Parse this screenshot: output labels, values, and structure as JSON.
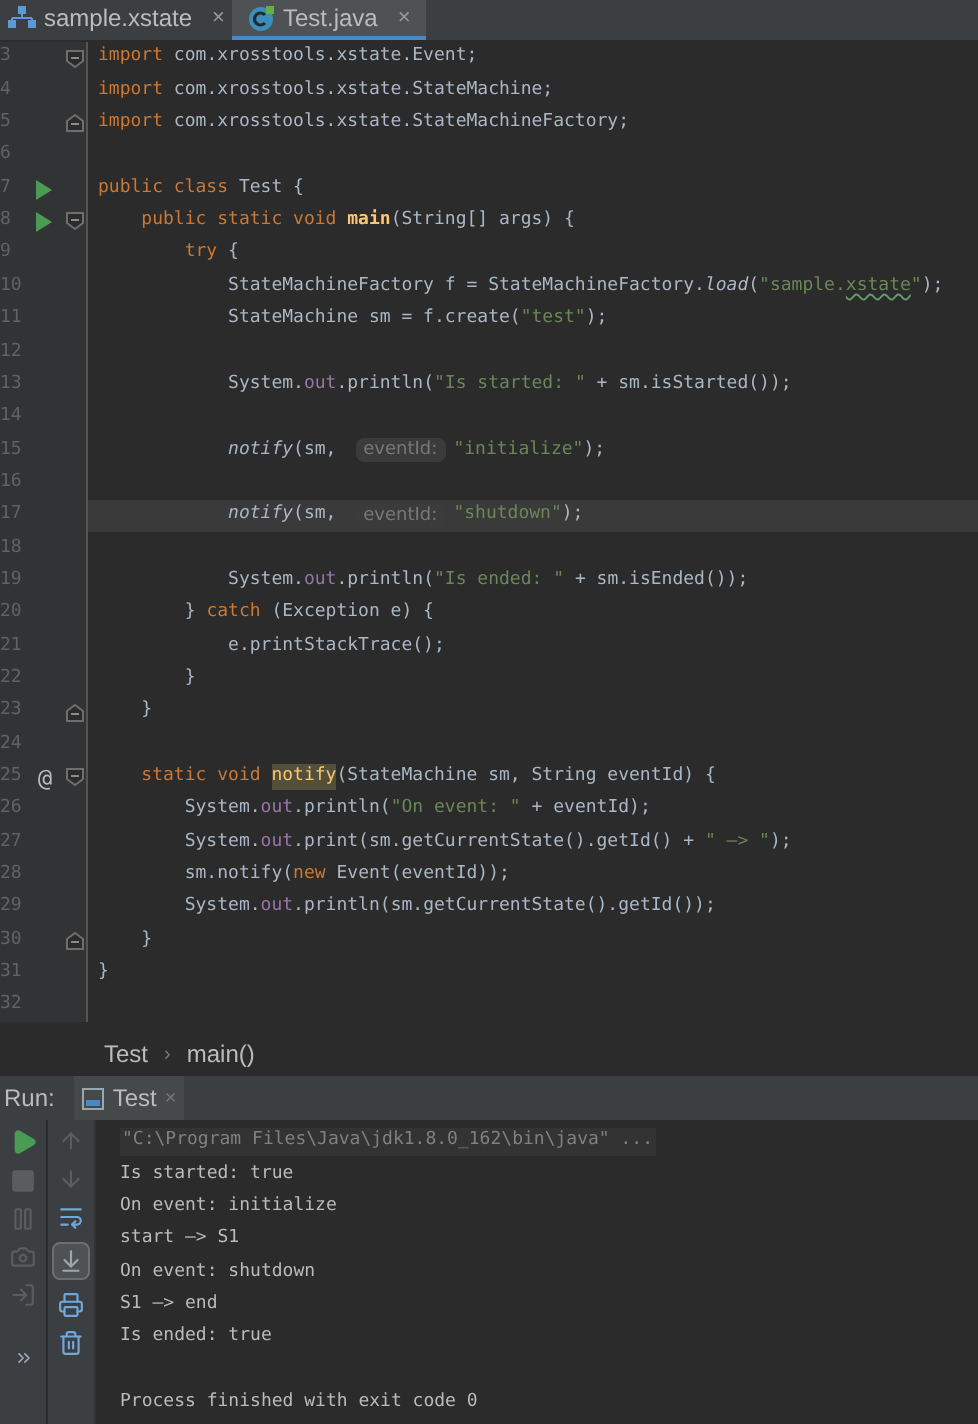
{
  "tabs": [
    {
      "label": "sample.xstate",
      "kind": "diagram",
      "selected": false,
      "close": "×"
    },
    {
      "label": "Test.java",
      "kind": "class",
      "selected": true,
      "close": "×"
    }
  ],
  "editor": {
    "lines": [
      {
        "n": "3",
        "fold_start": true,
        "fold_end": false,
        "runnable": false,
        "current": false,
        "code": [
          {
            "kind": "kw",
            "t": "import"
          },
          {
            "kind": "text",
            "t": " com.xrosstools.xstate.Event;"
          }
        ]
      },
      {
        "n": "4",
        "fold_start": false,
        "fold_end": false,
        "runnable": false,
        "current": false,
        "code": [
          {
            "kind": "kw",
            "t": "import"
          },
          {
            "kind": "text",
            "t": " com.xrosstools.xstate.StateMachine;"
          }
        ]
      },
      {
        "n": "5",
        "fold_start": false,
        "fold_end": true,
        "runnable": false,
        "current": false,
        "code": [
          {
            "kind": "kw",
            "t": "import"
          },
          {
            "kind": "text",
            "t": " com.xrosstools.xstate.StateMachineFactory;"
          }
        ]
      },
      {
        "n": "6",
        "fold_start": false,
        "fold_end": false,
        "runnable": false,
        "current": false
      },
      {
        "n": "7",
        "fold_start": false,
        "fold_end": false,
        "runnable": true,
        "current": false,
        "code": [
          {
            "kind": "kw",
            "t": "public class "
          },
          {
            "kind": "text",
            "t": "Test {"
          }
        ]
      },
      {
        "n": "8",
        "fold_start": true,
        "fold_end": false,
        "runnable": true,
        "current": false,
        "code": [
          {
            "kind": "kw",
            "t": "    public static void "
          },
          {
            "kind": "decl",
            "t": "main"
          },
          {
            "kind": "text",
            "t": "(String[] args) {"
          }
        ]
      },
      {
        "n": "9",
        "fold_start": false,
        "fold_end": false,
        "runnable": false,
        "current": false,
        "code": [
          {
            "kind": "kw",
            "t": "        try"
          },
          {
            "kind": "text",
            "t": " {"
          }
        ]
      },
      {
        "n": "10",
        "fold_start": false,
        "fold_end": false,
        "runnable": false,
        "current": false,
        "code": [
          {
            "kind": "text",
            "t": "            StateMachineFactory f = StateMachineFactory."
          },
          {
            "kind": "ital",
            "t": "load"
          },
          {
            "kind": "text",
            "t": "("
          },
          {
            "kind": "str",
            "t": "\"sample."
          },
          {
            "kind": "typo",
            "t": "xstate"
          },
          {
            "kind": "str",
            "t": "\""
          },
          {
            "kind": "text",
            "t": ");"
          }
        ]
      },
      {
        "n": "11",
        "fold_start": false,
        "fold_end": false,
        "runnable": false,
        "current": false,
        "code": [
          {
            "kind": "text",
            "t": "            StateMachine sm = f.create("
          },
          {
            "kind": "str",
            "t": "\"test\""
          },
          {
            "kind": "text",
            "t": ");"
          }
        ]
      },
      {
        "n": "12",
        "fold_start": false,
        "fold_end": false,
        "runnable": false,
        "current": false
      },
      {
        "n": "13",
        "fold_start": false,
        "fold_end": false,
        "runnable": false,
        "current": false,
        "code": [
          {
            "kind": "text",
            "t": "            System."
          },
          {
            "kind": "field",
            "t": "out"
          },
          {
            "kind": "text",
            "t": ".println("
          },
          {
            "kind": "str",
            "t": "\"Is started: \""
          },
          {
            "kind": "text",
            "t": " + sm.isStarted());"
          }
        ]
      },
      {
        "n": "14",
        "fold_start": false,
        "fold_end": false,
        "runnable": false,
        "current": false
      },
      {
        "n": "15",
        "fold_start": false,
        "fold_end": false,
        "runnable": false,
        "current": false,
        "code": [
          {
            "kind": "ital",
            "t": "            notify"
          },
          {
            "kind": "text",
            "t": "(sm, "
          },
          {
            "kind": "hint",
            "t": "eventId:"
          },
          {
            "kind": "str",
            "t": "\"initialize\""
          },
          {
            "kind": "text",
            "t": ");"
          }
        ]
      },
      {
        "n": "16",
        "fold_start": false,
        "fold_end": false,
        "runnable": false,
        "current": false
      },
      {
        "n": "17",
        "fold_start": false,
        "fold_end": false,
        "runnable": false,
        "current": true,
        "code": [
          {
            "kind": "ital",
            "t": "            notify"
          },
          {
            "kind": "text",
            "t": "(sm, "
          },
          {
            "kind": "hint",
            "t": "eventId:"
          },
          {
            "kind": "str",
            "t": "\"shutdown\""
          },
          {
            "kind": "text",
            "t": ");"
          }
        ]
      },
      {
        "n": "18",
        "fold_start": false,
        "fold_end": false,
        "runnable": false,
        "current": false
      },
      {
        "n": "19",
        "fold_start": false,
        "fold_end": false,
        "runnable": false,
        "current": false,
        "code": [
          {
            "kind": "text",
            "t": "            System."
          },
          {
            "kind": "field",
            "t": "out"
          },
          {
            "kind": "text",
            "t": ".println("
          },
          {
            "kind": "str",
            "t": "\"Is ended: \""
          },
          {
            "kind": "text",
            "t": " + sm.isEnded());"
          }
        ]
      },
      {
        "n": "20",
        "fold_start": false,
        "fold_end": false,
        "runnable": false,
        "current": false,
        "code": [
          {
            "kind": "text",
            "t": "        } "
          },
          {
            "kind": "kw",
            "t": "catch"
          },
          {
            "kind": "text",
            "t": " (Exception e) {"
          }
        ]
      },
      {
        "n": "21",
        "fold_start": false,
        "fold_end": false,
        "runnable": false,
        "current": false,
        "code": [
          {
            "kind": "text",
            "t": "            e.printStackTrace();"
          }
        ]
      },
      {
        "n": "22",
        "fold_start": false,
        "fold_end": false,
        "runnable": false,
        "current": false,
        "code": [
          {
            "kind": "text",
            "t": "        }"
          }
        ]
      },
      {
        "n": "23",
        "fold_start": false,
        "fold_end": true,
        "runnable": false,
        "current": false,
        "code": [
          {
            "kind": "text",
            "t": "    }"
          }
        ]
      },
      {
        "n": "24",
        "fold_start": false,
        "fold_end": false,
        "runnable": false,
        "current": false
      },
      {
        "n": "25",
        "marker": "@",
        "fold_start": true,
        "fold_end": false,
        "runnable": false,
        "current": false,
        "code": [
          {
            "kind": "kw",
            "t": "    static void "
          },
          {
            "kind": "usage",
            "t": "notify"
          },
          {
            "kind": "text",
            "t": "(StateMachine sm, String eventId) {"
          }
        ]
      },
      {
        "n": "26",
        "fold_start": false,
        "fold_end": false,
        "runnable": false,
        "current": false,
        "code": [
          {
            "kind": "text",
            "t": "        System."
          },
          {
            "kind": "field",
            "t": "out"
          },
          {
            "kind": "text",
            "t": ".println("
          },
          {
            "kind": "str",
            "t": "\"On event: \""
          },
          {
            "kind": "text",
            "t": " + eventId);"
          }
        ]
      },
      {
        "n": "27",
        "fold_start": false,
        "fold_end": false,
        "runnable": false,
        "current": false,
        "code": [
          {
            "kind": "text",
            "t": "        System."
          },
          {
            "kind": "field",
            "t": "out"
          },
          {
            "kind": "text",
            "t": ".print(sm.getCurrentState().getId() + "
          },
          {
            "kind": "str",
            "t": "\" —> \""
          },
          {
            "kind": "text",
            "t": ");"
          }
        ]
      },
      {
        "n": "28",
        "fold_start": false,
        "fold_end": false,
        "runnable": false,
        "current": false,
        "code": [
          {
            "kind": "text",
            "t": "        sm.notify("
          },
          {
            "kind": "kw",
            "t": "new"
          },
          {
            "kind": "text",
            "t": " Event(eventId));"
          }
        ]
      },
      {
        "n": "29",
        "fold_start": false,
        "fold_end": false,
        "runnable": false,
        "current": false,
        "code": [
          {
            "kind": "text",
            "t": "        System."
          },
          {
            "kind": "field",
            "t": "out"
          },
          {
            "kind": "text",
            "t": ".println(sm.getCurrentState().getId());"
          }
        ]
      },
      {
        "n": "30",
        "fold_start": false,
        "fold_end": true,
        "runnable": false,
        "current": false,
        "code": [
          {
            "kind": "text",
            "t": "    }"
          }
        ]
      },
      {
        "n": "31",
        "fold_start": false,
        "fold_end": false,
        "runnable": false,
        "current": false,
        "code": [
          {
            "kind": "text",
            "t": "}"
          }
        ]
      },
      {
        "n": "32",
        "fold_start": false,
        "fold_end": false,
        "runnable": false,
        "current": false
      }
    ]
  },
  "breadcrumb": {
    "items": [
      "Test",
      "main()"
    ],
    "separator": "›"
  },
  "run_panel": {
    "label": "Run:",
    "tab": {
      "label": "Test",
      "close": "×"
    },
    "scroll_to_end_on": true,
    "console": [
      {
        "kind": "cmd",
        "text": "\"C:\\Program Files\\Java\\jdk1.8.0_162\\bin\\java\" ..."
      },
      {
        "kind": "out",
        "text": "Is started: true"
      },
      {
        "kind": "out",
        "text": "On event: initialize"
      },
      {
        "kind": "out",
        "text": "start —> S1"
      },
      {
        "kind": "out",
        "text": "On event: shutdown"
      },
      {
        "kind": "out",
        "text": "S1 —> end"
      },
      {
        "kind": "out",
        "text": "Is ended: true"
      },
      {
        "kind": "exit",
        "text": "Process finished with exit code 0"
      }
    ]
  }
}
